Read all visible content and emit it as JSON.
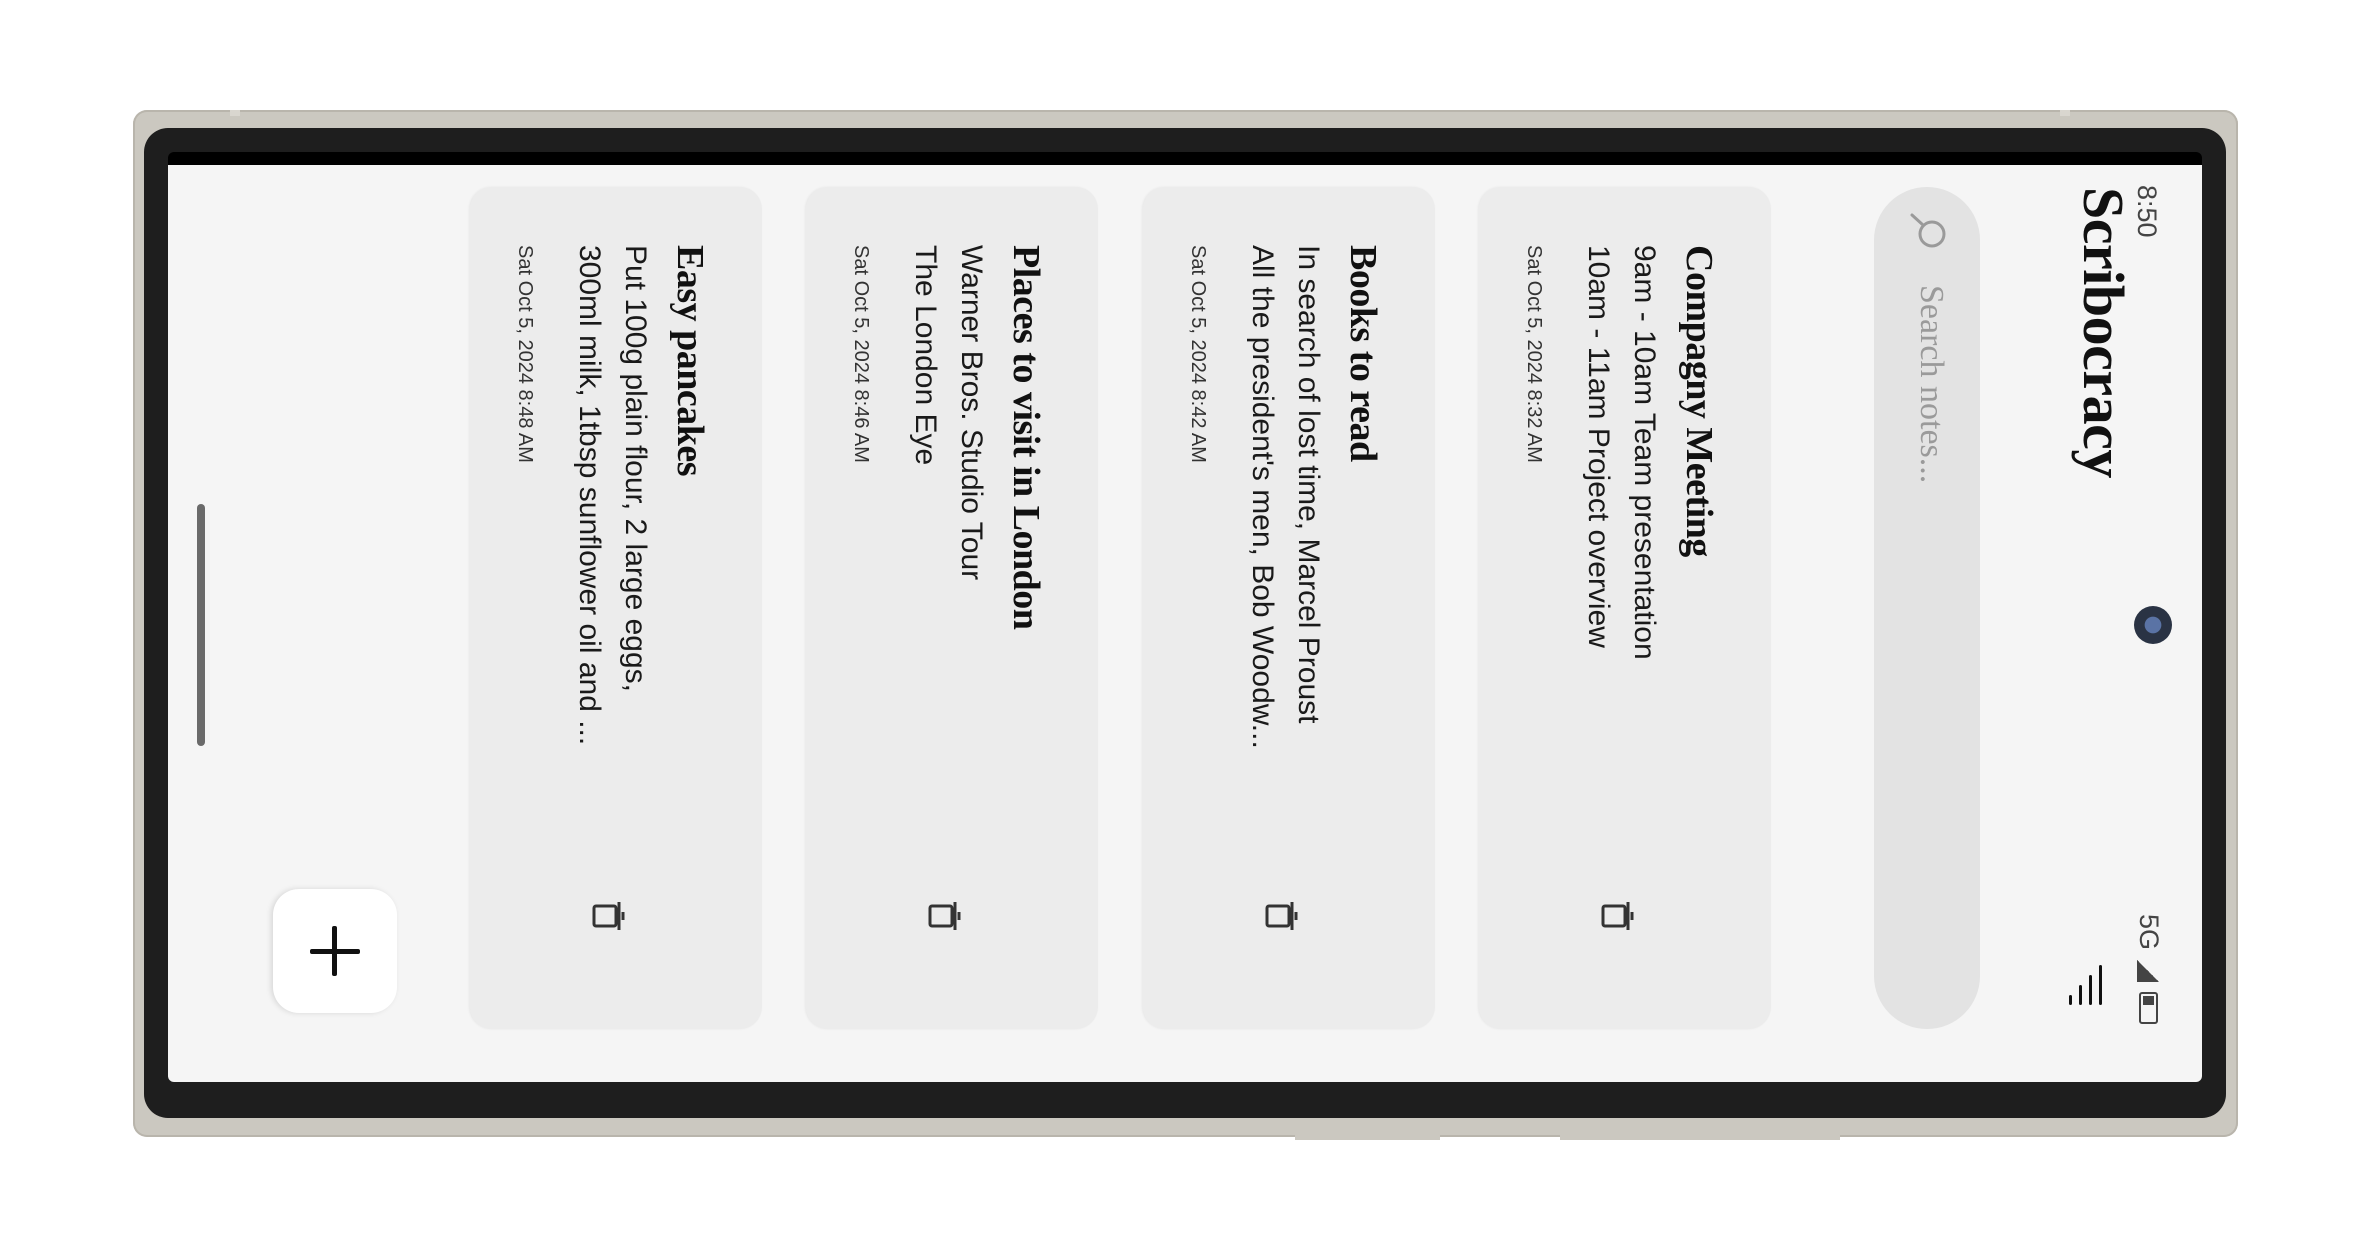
{
  "status_bar": {
    "time": "8:50",
    "network": "5G"
  },
  "header": {
    "title": "Scribocracy"
  },
  "search": {
    "placeholder": "Search notes..."
  },
  "notes": [
    {
      "title": "Compagny Meeting",
      "lines": [
        "9am - 10am Team presentation",
        "10am - 11am Project overview"
      ],
      "date": "Sat Oct 5, 2024 8:32 AM"
    },
    {
      "title": "Books to read",
      "lines": [
        "In search of lost time, Marcel Proust",
        "All the president's men, Bob Woodw..."
      ],
      "date": "Sat Oct 5, 2024 8:42 AM"
    },
    {
      "title": "Places to visit in London",
      "lines": [
        "Warner Bros. Studio Tour",
        "The London Eye"
      ],
      "date": "Sat Oct 5, 2024 8:46 AM"
    },
    {
      "title": "Easy pancakes",
      "lines": [
        "Put 100g plain flour, 2 large eggs,",
        "300ml milk, 1tbsp sunflower oil and ..."
      ],
      "date": "Sat Oct 5, 2024 8:48 AM"
    }
  ],
  "icons": {
    "menu": "sort-lines-icon",
    "search": "search-icon",
    "delete": "trash-icon",
    "add": "plus-icon"
  },
  "colors": {
    "background": "#f5f5f5",
    "card": "#ececec",
    "search_bg": "#e3e3e3",
    "text": "#111111"
  }
}
